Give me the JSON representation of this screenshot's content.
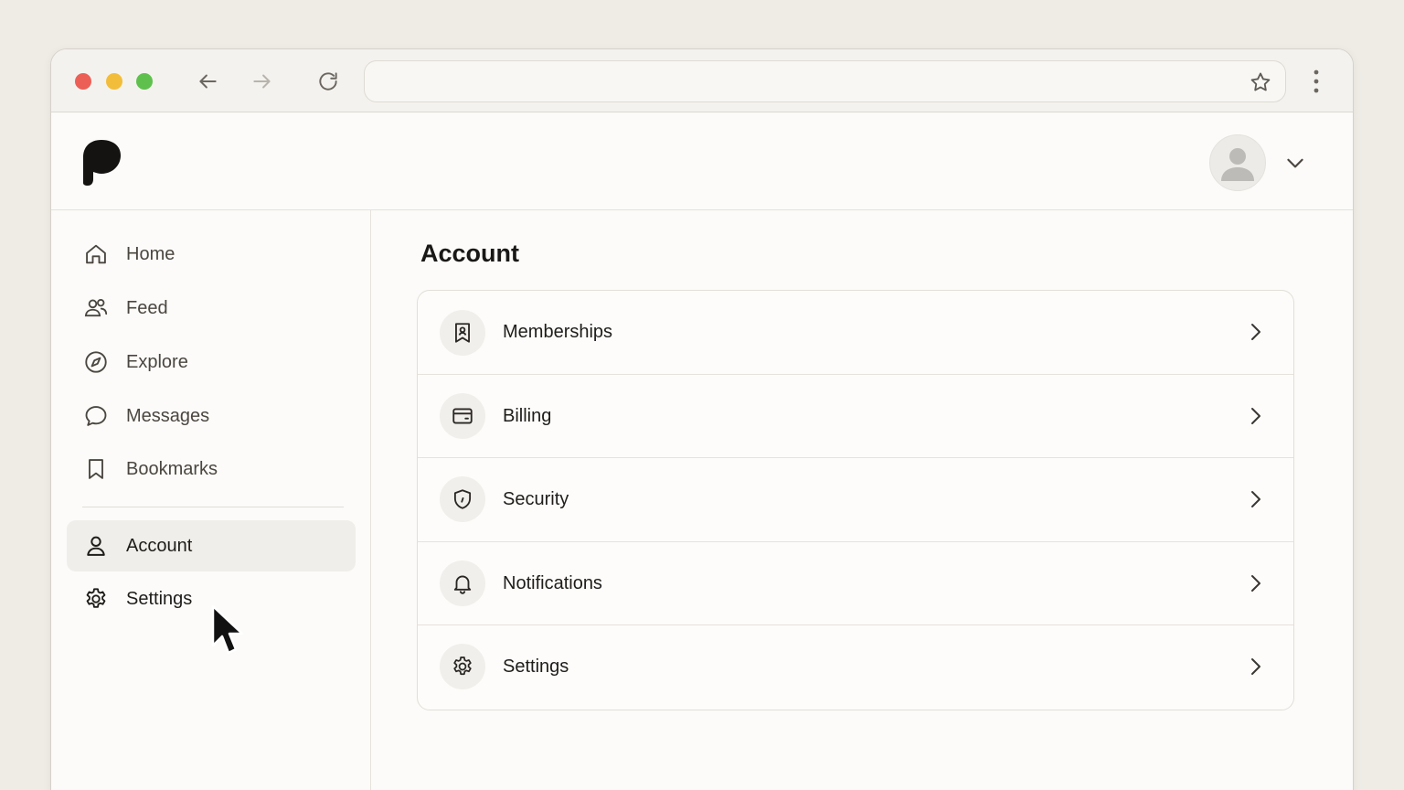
{
  "browser": {
    "url": "",
    "controls": [
      "back-arrow-icon",
      "forward-arrow-icon",
      "reload-icon",
      "star-icon",
      "more-vertical-icon"
    ]
  },
  "colors": {
    "window_close": "#ec5f57",
    "window_minimize": "#f2bd3a",
    "window_maximize": "#5fc04e",
    "active_item_bg": "#f0eeea",
    "text_primary": "#1f1d1a",
    "text_secondary": "#4a4640"
  },
  "header": {
    "logo_icon": "patreon-logo-icon",
    "avatar_icon": "user-avatar-icon",
    "menu_icon": "chevron-down-icon"
  },
  "sidebar": {
    "items": [
      {
        "label": "Home",
        "icon": "home-icon"
      },
      {
        "label": "Feed",
        "icon": "users-icon"
      },
      {
        "label": "Explore",
        "icon": "compass-icon"
      },
      {
        "label": "Messages",
        "icon": "chat-bubble-icon"
      },
      {
        "label": "Bookmarks",
        "icon": "bookmark-icon"
      }
    ],
    "secondary_items": [
      {
        "label": "Account",
        "icon": "user-icon",
        "active": true
      },
      {
        "label": "Settings",
        "icon": "gear-icon",
        "active": false
      }
    ]
  },
  "main": {
    "title": "Account",
    "rows": [
      {
        "label": "Memberships",
        "icon": "membership-badge-icon"
      },
      {
        "label": "Billing",
        "icon": "credit-card-icon"
      },
      {
        "label": "Security",
        "icon": "shield-icon"
      },
      {
        "label": "Notifications",
        "icon": "bell-icon"
      },
      {
        "label": "Settings",
        "icon": "gear-icon"
      }
    ]
  }
}
